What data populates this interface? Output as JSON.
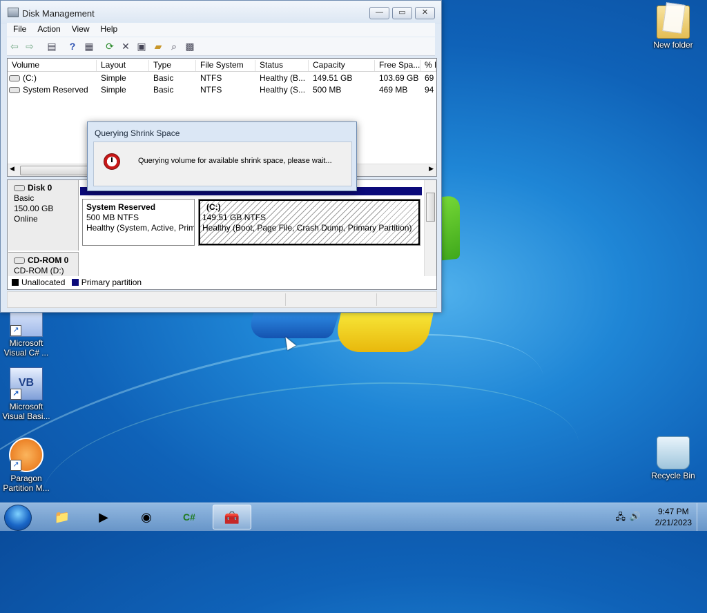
{
  "window": {
    "title": "Disk Management",
    "menu": [
      "File",
      "Action",
      "View",
      "Help"
    ]
  },
  "toolbar": {
    "icons": [
      "back-arrow-icon",
      "forward-arrow-icon",
      "console-tree-icon",
      "help-icon",
      "properties-view-icon",
      "refresh-icon",
      "delete-icon",
      "properties-icon",
      "open-icon",
      "explore-icon",
      "rescan-icon"
    ]
  },
  "volume_list": {
    "columns": [
      "Volume",
      "Layout",
      "Type",
      "File System",
      "Status",
      "Capacity",
      "Free Spa...",
      "% F"
    ],
    "rows": [
      [
        "(C:)",
        "Simple",
        "Basic",
        "NTFS",
        "Healthy (B...",
        "149.51 GB",
        "103.69 GB",
        "69"
      ],
      [
        "System Reserved",
        "Simple",
        "Basic",
        "NTFS",
        "Healthy (S...",
        "500 MB",
        "469 MB",
        "94"
      ]
    ]
  },
  "disks": {
    "disk0": {
      "name": "Disk 0",
      "type": "Basic",
      "size": "150.00 GB",
      "state": "Online"
    },
    "cdrom0": {
      "name": "CD-ROM 0",
      "drive": "CD-ROM (D:)"
    },
    "partitions": {
      "sys": {
        "name": "System Reserved",
        "size": "500 MB NTFS",
        "status": "Healthy (System, Active, Primary Partition)"
      },
      "c": {
        "name": "(C:)",
        "size": "149.51 GB NTFS",
        "status": "Healthy (Boot, Page File, Crash Dump, Primary Partition)"
      }
    }
  },
  "legend": {
    "unallocated": "Unallocated",
    "primary": "Primary partition",
    "unallocated_color": "#000000",
    "primary_color": "#0b0a7a"
  },
  "dialog": {
    "title": "Querying Shrink Space",
    "message": "Querying volume for available shrink space, please wait..."
  },
  "desktop": {
    "icons": {
      "new_folder": "New folder",
      "vcsharp": "Microsoft Visual C# ...",
      "vbasic": "Microsoft Visual Basi...",
      "paragon": "Paragon Partition M...",
      "recycle": "Recycle Bin"
    }
  },
  "taskbar": {
    "time": "9:47 PM",
    "date": "2/21/2023",
    "apps": [
      "explorer-icon",
      "media-player-icon",
      "chrome-icon",
      "visual-csharp-icon",
      "computer-management-icon"
    ]
  }
}
